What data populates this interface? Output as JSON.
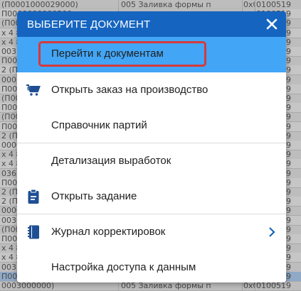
{
  "background_table": {
    "rows": [
      {
        "c1": "(П0001000029000)",
        "c2": "005 Заливка формы п",
        "c4": "0х0",
        "c3": "0100519"
      },
      {
        "c1": "П0000000000300",
        "c2": "",
        "c4": "",
        "c3": "0100519"
      },
      {
        "c1": "(П0000000000300)",
        "c2": "",
        "c4": "",
        "c3": "0100519"
      },
      {
        "c1": "х 4 8",
        "c2": "",
        "c4": "",
        "c3": "0100519"
      },
      {
        "c1": "х 4 8",
        "c2": "",
        "c4": "",
        "c3": "0100519"
      },
      {
        "c1": "003",
        "c2": "",
        "c4": "",
        "c3": "0100519"
      },
      {
        "c1": "П0003",
        "c2": "",
        "c4": "",
        "c3": "0100519"
      },
      {
        "c1": "2 (П0",
        "c2": "",
        "c4": "",
        "c3": "0100519"
      },
      {
        "c1": "0001",
        "c2": "",
        "c4": "",
        "c3": "0100519"
      },
      {
        "c1": "П000",
        "c2": "",
        "c4": "",
        "c3": "0100519"
      },
      {
        "c1": "(П00",
        "c2": "",
        "c4": "",
        "c3": "0100519"
      },
      {
        "c1": "П000",
        "c2": "",
        "c4": "",
        "c3": "0100519"
      },
      {
        "c1": "(П00",
        "c2": "",
        "c4": "",
        "c3": "0100519"
      },
      {
        "c1": "П000",
        "c2": "",
        "c4": "",
        "c3": "0100519"
      },
      {
        "c1": "2 (П0",
        "c2": "",
        "c4": "",
        "c3": "0100519"
      },
      {
        "c1": "0000",
        "c2": "",
        "c4": "",
        "c3": "0100519"
      },
      {
        "c1": "х 4 8",
        "c2": "",
        "c4": "",
        "c3": "0100519"
      },
      {
        "c1": "х 4 8",
        "c2": "",
        "c4": "",
        "c3": "0100519"
      },
      {
        "c1": "036",
        "c2": "",
        "c4": "",
        "c3": "0100519"
      },
      {
        "c1": "П0036",
        "c2": "",
        "c4": "",
        "c3": "0100519"
      },
      {
        "c1": "2 (П0",
        "c2": "",
        "c4": "",
        "c3": "0100519"
      },
      {
        "c1": "2 (П0",
        "c2": "",
        "c4": "",
        "c3": "0100519"
      },
      {
        "c1": "0000",
        "c2": "",
        "c4": "",
        "c3": "0100519"
      },
      {
        "c1": "0036",
        "c2": "",
        "c4": "",
        "c3": "0100519"
      },
      {
        "c1": "(П00",
        "c2": "",
        "c4": "",
        "c3": "0100519"
      },
      {
        "c1": "П000",
        "c2": "",
        "c4": "",
        "c3": "0100519"
      },
      {
        "c1": "х 4 8",
        "c2": "",
        "c4": "",
        "c3": "0100519"
      },
      {
        "c1": "х 4 8",
        "c2": "",
        "c4": "",
        "c3": "0100519"
      },
      {
        "c1": "003",
        "c2": "",
        "c4": "",
        "c3": "0100519"
      },
      {
        "c1": "П000",
        "c2": "",
        "c4": "",
        "c3": "0100519"
      },
      {
        "c1": "0003000000)",
        "c2": "005 Заливка формы п",
        "c4": "0х0",
        "c3": "0100519"
      }
    ]
  },
  "dialog": {
    "title": "ВЫБЕРИТЕ ДОКУМЕНТ",
    "header_color": "#1565c0",
    "active_color": "#42a5f5",
    "highlight_color": "#d6393c",
    "items": [
      {
        "label": "Перейти к документам",
        "icon": "",
        "active": true
      },
      {
        "label": "Открыть заказ на производство",
        "icon": "cart-icon"
      },
      {
        "label": "Справочник партий",
        "icon": ""
      },
      {
        "label": "Детализация выработок",
        "icon": ""
      },
      {
        "label": "Открыть задание",
        "icon": "clipboard-icon"
      },
      {
        "label": "Журнал корректировок",
        "icon": "journal-icon",
        "has_submenu": true
      },
      {
        "label": "Настройка доступа к данным",
        "icon": ""
      }
    ]
  }
}
